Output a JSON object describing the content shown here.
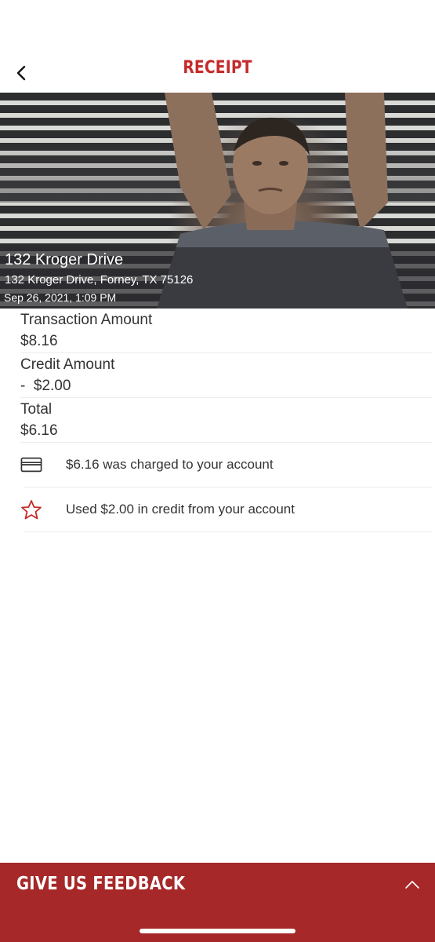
{
  "header": {
    "title": "RECEIPT",
    "back_icon": "chevron-left-icon"
  },
  "location": {
    "name": "132 Kroger Drive",
    "address": "132 Kroger Drive, Forney, TX 75126",
    "datetime": "Sep 26, 2021, 1:09 PM"
  },
  "amounts": [
    {
      "label": "Transaction Amount",
      "value": "$8.16"
    },
    {
      "label": "Credit Amount",
      "value": "-  $2.00"
    },
    {
      "label": "Total",
      "value": "$6.16"
    }
  ],
  "info": [
    {
      "icon": "credit-card-icon",
      "text": "$6.16 was charged to your account"
    },
    {
      "icon": "star-icon",
      "text": "Used $2.00 in credit from your account"
    }
  ],
  "footer": {
    "label": "GIVE US FEEDBACK",
    "toggle_icon": "chevron-up-icon"
  },
  "colors": {
    "brand_red": "#c52b2b",
    "footer_red": "#a62828"
  }
}
